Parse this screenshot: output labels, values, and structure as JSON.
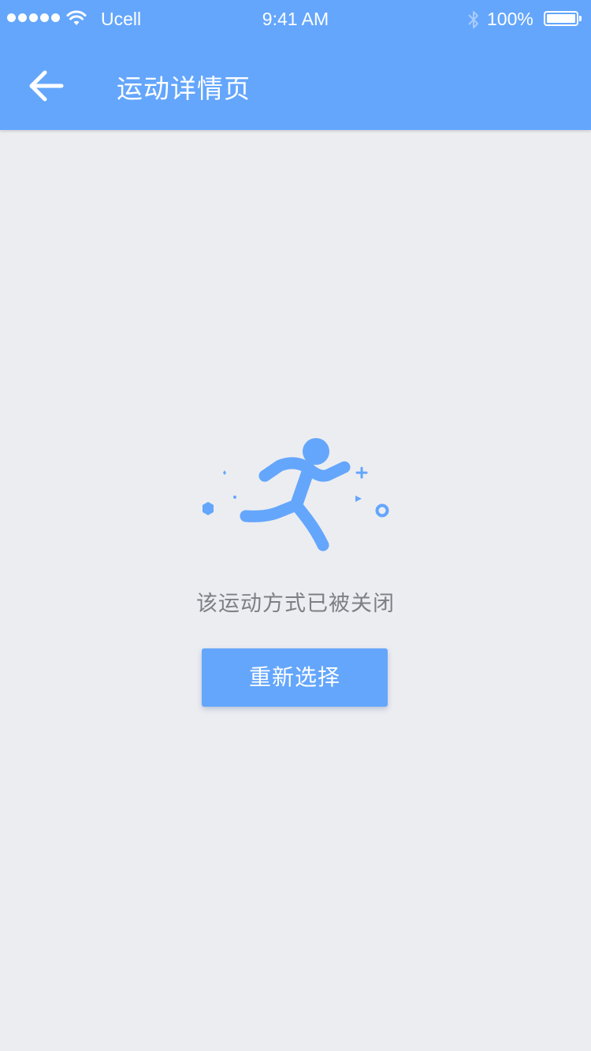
{
  "status_bar": {
    "carrier": "Ucell",
    "time": "9:41 AM",
    "battery": "100%"
  },
  "header": {
    "title": "运动详情页",
    "back_icon": "arrow-left-icon"
  },
  "empty_state": {
    "icon": "running-person-icon",
    "message": "该运动方式已被关闭",
    "button_label": "重新选择"
  },
  "colors": {
    "primary": "#64a6fc",
    "background": "#ecedf1",
    "message_text": "#7d7f84"
  }
}
